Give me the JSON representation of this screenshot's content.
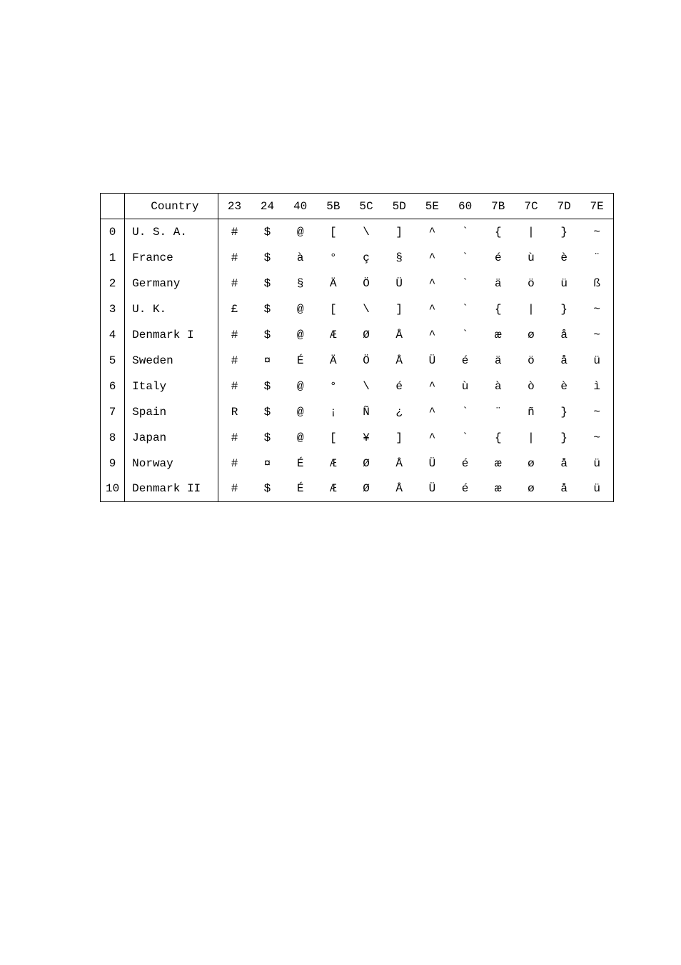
{
  "chart_data": {
    "type": "table",
    "title": "",
    "columns": [
      "",
      "Country",
      "23",
      "24",
      "40",
      "5B",
      "5C",
      "5D",
      "5E",
      "60",
      "7B",
      "7C",
      "7D",
      "7E"
    ],
    "rows": [
      [
        "0",
        "U. S. A.",
        "#",
        "$",
        "@",
        "[",
        "\\",
        "]",
        "^",
        "`",
        "{",
        "|",
        "}",
        "~"
      ],
      [
        "1",
        "France",
        "#",
        "$",
        "à",
        "°",
        "ç",
        "§",
        "^",
        "`",
        "é",
        "ù",
        "è",
        "¨"
      ],
      [
        "2",
        "Germany",
        "#",
        "$",
        "§",
        "Ä",
        "Ö",
        "Ü",
        "^",
        "`",
        "ä",
        "ö",
        "ü",
        "ß"
      ],
      [
        "3",
        "U. K.",
        "£",
        "$",
        "@",
        "[",
        "\\",
        "]",
        "^",
        "`",
        "{",
        "|",
        "}",
        "~"
      ],
      [
        "4",
        "Denmark I",
        "#",
        "$",
        "@",
        "Æ",
        "Ø",
        "Å",
        "^",
        "`",
        "æ",
        "ø",
        "å",
        "~"
      ],
      [
        "5",
        "Sweden",
        "#",
        "¤",
        "É",
        "Ä",
        "Ö",
        "Å",
        "Ü",
        "é",
        "ä",
        "ö",
        "å",
        "ü"
      ],
      [
        "6",
        "Italy",
        "#",
        "$",
        "@",
        "°",
        "\\",
        "é",
        "^",
        "ù",
        "à",
        "ò",
        "è",
        "ì"
      ],
      [
        "7",
        "Spain",
        "R",
        "$",
        "@",
        "¡",
        "Ñ",
        "¿",
        "^",
        "`",
        "¨",
        "ñ",
        "}",
        "~"
      ],
      [
        "8",
        "Japan",
        "#",
        "$",
        "@",
        "[",
        "¥",
        "]",
        "^",
        "`",
        "{",
        "|",
        "}",
        "~"
      ],
      [
        "9",
        "Norway",
        "#",
        "¤",
        "É",
        "Æ",
        "Ø",
        "Å",
        "Ü",
        "é",
        "æ",
        "ø",
        "å",
        "ü"
      ],
      [
        "10",
        "Denmark II",
        "#",
        "$",
        "É",
        "Æ",
        "Ø",
        "Å",
        "Ü",
        "é",
        "æ",
        "ø",
        "å",
        "ü"
      ]
    ]
  }
}
